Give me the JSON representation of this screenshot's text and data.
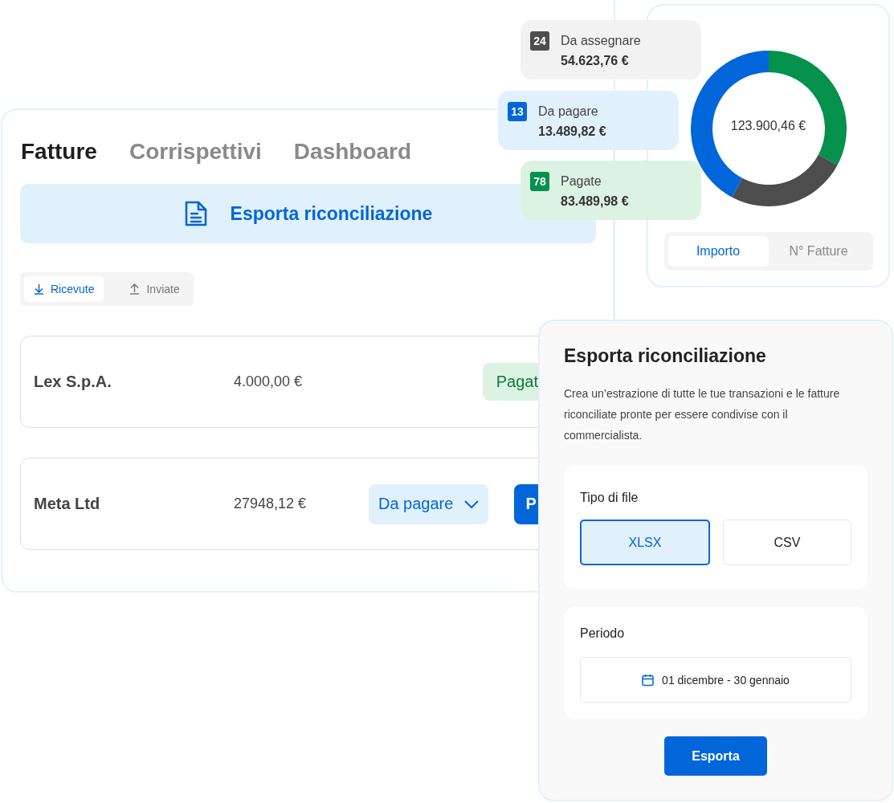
{
  "tabs": [
    {
      "label": "Fatture",
      "selected": true
    },
    {
      "label": "Corrispettivi",
      "selected": false
    },
    {
      "label": "Dashboard",
      "selected": false
    }
  ],
  "export_banner": {
    "label": "Esporta riconciliazione"
  },
  "segments": [
    {
      "label": "Ricevute",
      "kind": "download",
      "selected": true
    },
    {
      "label": "Inviate",
      "kind": "upload",
      "selected": false
    }
  ],
  "invoices": [
    {
      "name": "Lex S.p.A.",
      "amount": "4.000,00 €",
      "status": {
        "kind": "badge",
        "label": "Pagat"
      }
    },
    {
      "name": "Meta Ltd",
      "amount": "27948,12 €",
      "status": {
        "kind": "dropdown",
        "label": "Da pagare"
      },
      "action": "P"
    }
  ],
  "stats": [
    {
      "count": "24",
      "label": "Da assegnare",
      "amount": "54.623,76 €",
      "color": "#4d4d4d"
    },
    {
      "count": "13",
      "label": "Da pagare",
      "amount": "13.489,82 €",
      "color": "#0066d9"
    },
    {
      "count": "78",
      "label": "Pagate",
      "amount": "83.489,98 €",
      "color": "#04914b"
    }
  ],
  "chart": {
    "total": "123.900,46 €",
    "toggle": [
      {
        "label": "Importo",
        "selected": true
      },
      {
        "label": "N° Fatture",
        "selected": false
      }
    ]
  },
  "dialog": {
    "title": "Esporta riconciliazione",
    "description": "Crea un’estrazione di tutte le tue transazioni e le fatture riconciliate pronte per essere condivise con il commercialista.",
    "file_type": {
      "label": "Tipo di file",
      "options": [
        {
          "label": "XLSX",
          "selected": true
        },
        {
          "label": "CSV",
          "selected": false
        }
      ]
    },
    "period": {
      "label": "Periodo",
      "value": "01 dicembre - 30 gennaio"
    },
    "button": "Esporta"
  }
}
